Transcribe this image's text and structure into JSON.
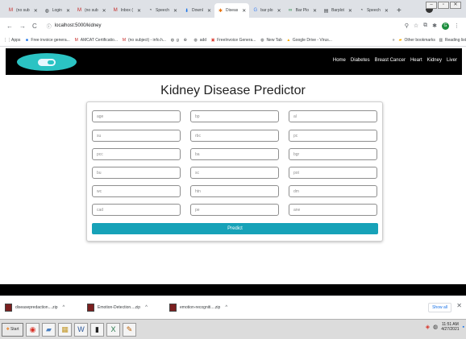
{
  "tabs": [
    {
      "label": "(no sub",
      "icon": "gmail-icon",
      "active": false
    },
    {
      "label": "Login",
      "icon": "globe-icon",
      "active": false
    },
    {
      "label": "(no sub",
      "icon": "gmail-icon",
      "active": false
    },
    {
      "label": "Inbox (",
      "icon": "gmail-icon",
      "active": false
    },
    {
      "label": "Speech",
      "icon": "github-icon",
      "active": false
    },
    {
      "label": "Downl",
      "icon": "download-icon",
      "active": false
    },
    {
      "label": "Diseas",
      "icon": "app-icon",
      "active": true
    },
    {
      "label": "bar plo",
      "icon": "google-icon",
      "active": false
    },
    {
      "label": "Bar Plo",
      "icon": "web-icon",
      "active": false
    },
    {
      "label": "Barplot",
      "icon": "doc-icon",
      "active": false
    },
    {
      "label": "Speech",
      "icon": "github-icon",
      "active": false
    }
  ],
  "address_bar": {
    "url": "localhost:5000/kidney"
  },
  "bookmarks": [
    {
      "label": "Apps",
      "icon": "apps-icon"
    },
    {
      "label": "Free invoice genera...",
      "icon": "invoice-icon"
    },
    {
      "label": "AMCAT Certificatio...",
      "icon": "gmail-icon"
    },
    {
      "label": "(no subject) - info.h...",
      "icon": "gmail-icon"
    },
    {
      "label": "g",
      "icon": "globe-icon"
    },
    {
      "label": "",
      "icon": "grid-icon"
    },
    {
      "label": "add",
      "icon": "globe-icon"
    },
    {
      "label": "FreeInvoice Genera...",
      "icon": "invoice-icon"
    },
    {
      "label": "New Tab",
      "icon": "globe-icon"
    },
    {
      "label": "Google Drive - Virus...",
      "icon": "drive-icon"
    }
  ],
  "bookmarks_right": {
    "more": "»",
    "other": "Other bookmarks",
    "reading": "Reading list"
  },
  "app_nav": {
    "links": [
      "Home",
      "Diabetes",
      "Breast Cancer",
      "Heart",
      "Kidney",
      "Liver"
    ]
  },
  "page": {
    "title": "Kidney Disease Predictor",
    "fields": [
      "age",
      "bp",
      "al",
      "su",
      "rbc",
      "pc",
      "pcc",
      "ba",
      "bgr",
      "bu",
      "sc",
      "pot",
      "wc",
      "htn",
      "dm",
      "cad",
      "pe",
      "ane"
    ],
    "predict_label": "Predict"
  },
  "downloads": [
    {
      "name": "diseasepredaction....zip"
    },
    {
      "name": "Emotion-Detection....zip"
    },
    {
      "name": "emotion-recogniti....zip"
    }
  ],
  "show_all": "Show all",
  "taskbar": {
    "start": "Start",
    "time": "11:51 AM",
    "date": "4/27/2021"
  }
}
